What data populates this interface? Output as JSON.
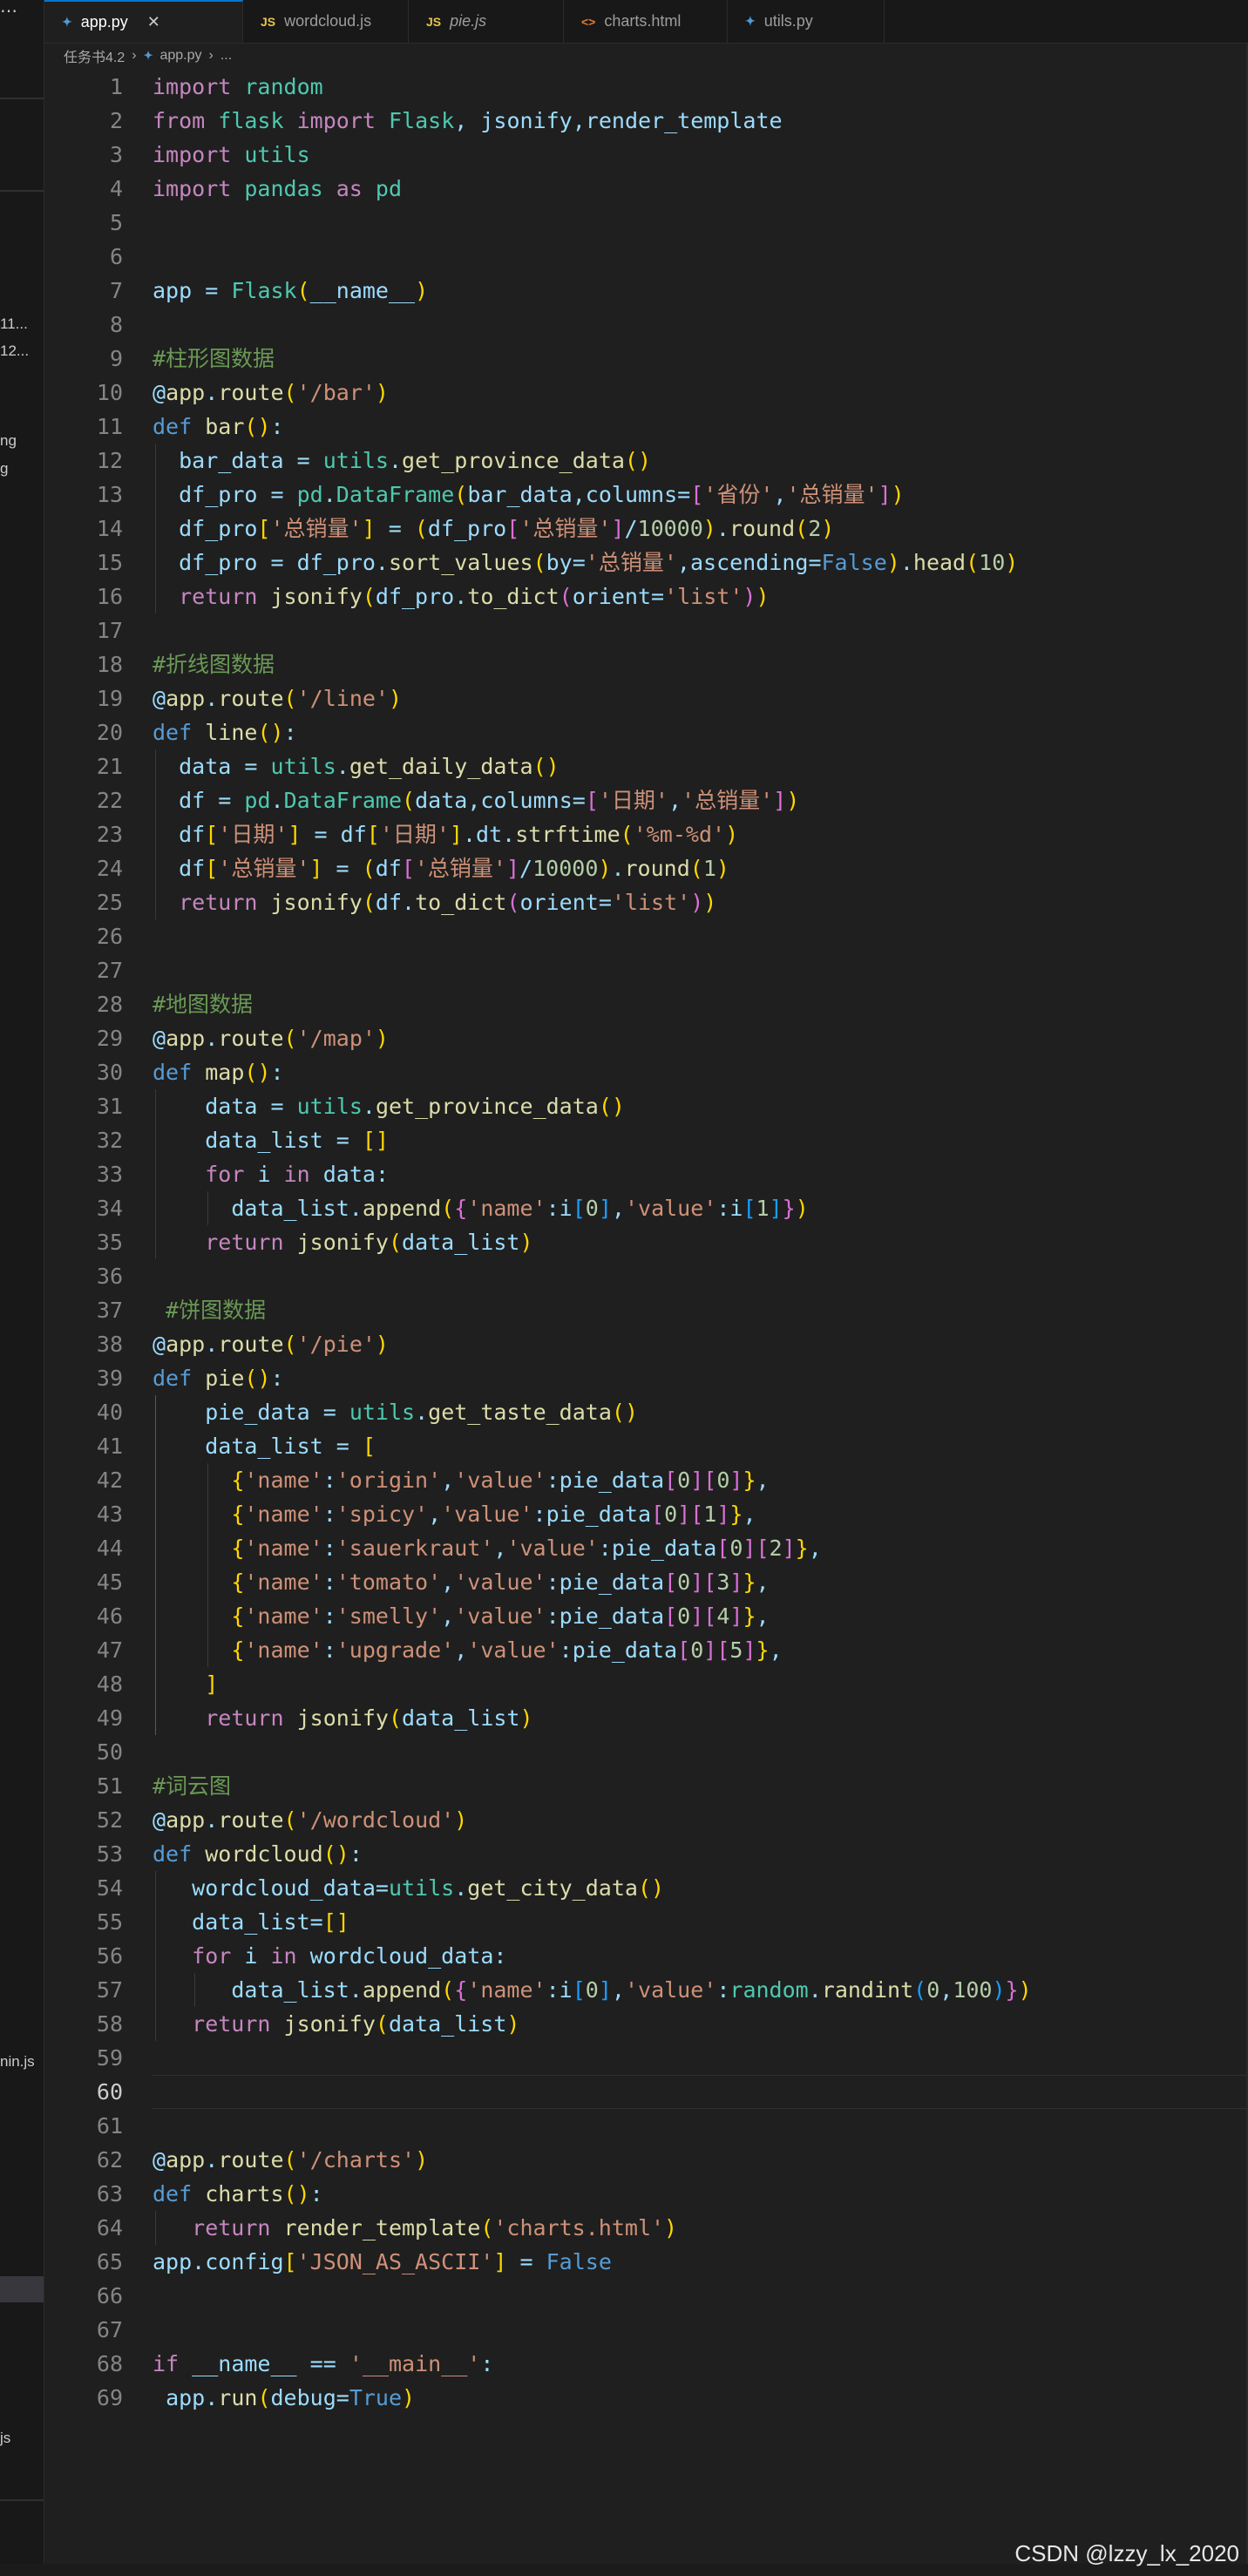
{
  "tabs": [
    {
      "label": "app.py",
      "icon": "python-icon",
      "active": true
    },
    {
      "label": "wordcloud.js",
      "icon": "js-icon"
    },
    {
      "label": "pie.js",
      "icon": "js-icon",
      "italic": true
    },
    {
      "label": "charts.html",
      "icon": "html-icon"
    },
    {
      "label": "utils.py",
      "icon": "python-icon"
    }
  ],
  "breadcrumb": {
    "folder": "任务书4.2",
    "file": "app.py",
    "symbol": "..."
  },
  "sidebar_fragments": [
    "11...",
    "12...",
    "ng",
    "g",
    "nin.js",
    "js"
  ],
  "editor": {
    "active_line": 60,
    "lines": [
      "import random",
      "from flask import Flask, jsonify,render_template",
      "import utils",
      "import pandas as pd",
      "",
      "",
      "app = Flask(__name__)",
      "",
      "#柱形图数据",
      "@app.route('/bar')",
      "def bar():",
      "  bar_data = utils.get_province_data()",
      "  df_pro = pd.DataFrame(bar_data,columns=['省份','总销量'])",
      "  df_pro['总销量'] = (df_pro['总销量']/10000).round(2)",
      "  df_pro = df_pro.sort_values(by='总销量',ascending=False).head(10)",
      "  return jsonify(df_pro.to_dict(orient='list'))",
      "",
      "#折线图数据",
      "@app.route('/line')",
      "def line():",
      "  data = utils.get_daily_data()",
      "  df = pd.DataFrame(data,columns=['日期','总销量'])",
      "  df['日期'] = df['日期'].dt.strftime('%m-%d')",
      "  df['总销量'] = (df['总销量']/10000).round(1)",
      "  return jsonify(df.to_dict(orient='list'))",
      "",
      "",
      "#地图数据",
      "@app.route('/map')",
      "def map():",
      "    data = utils.get_province_data()",
      "    data_list = []",
      "    for i in data:",
      "      data_list.append({'name':i[0],'value':i[1]})",
      "    return jsonify(data_list)",
      "",
      " #饼图数据",
      "@app.route('/pie')",
      "def pie():",
      "    pie_data = utils.get_taste_data()",
      "    data_list = [",
      "      {'name':'origin','value':pie_data[0][0]},",
      "      {'name':'spicy','value':pie_data[0][1]},",
      "      {'name':'sauerkraut','value':pie_data[0][2]},",
      "      {'name':'tomato','value':pie_data[0][3]},",
      "      {'name':'smelly','value':pie_data[0][4]},",
      "      {'name':'upgrade','value':pie_data[0][5]},",
      "    ]",
      "    return jsonify(data_list)",
      "",
      "#词云图",
      "@app.route('/wordcloud')",
      "def wordcloud():",
      "   wordcloud_data=utils.get_city_data()",
      "   data_list=[]",
      "   for i in wordcloud_data:",
      "      data_list.append({'name':i[0],'value':random.randint(0,100)})",
      "   return jsonify(data_list)",
      "",
      "",
      "",
      "@app.route('/charts')",
      "def charts():",
      "   return render_template('charts.html')",
      "app.config['JSON_AS_ASCII'] = False",
      "",
      "",
      "if __name__ == '__main__':",
      " app.run(debug=True)"
    ]
  },
  "watermark": "CSDN @lzzy_lx_2020"
}
